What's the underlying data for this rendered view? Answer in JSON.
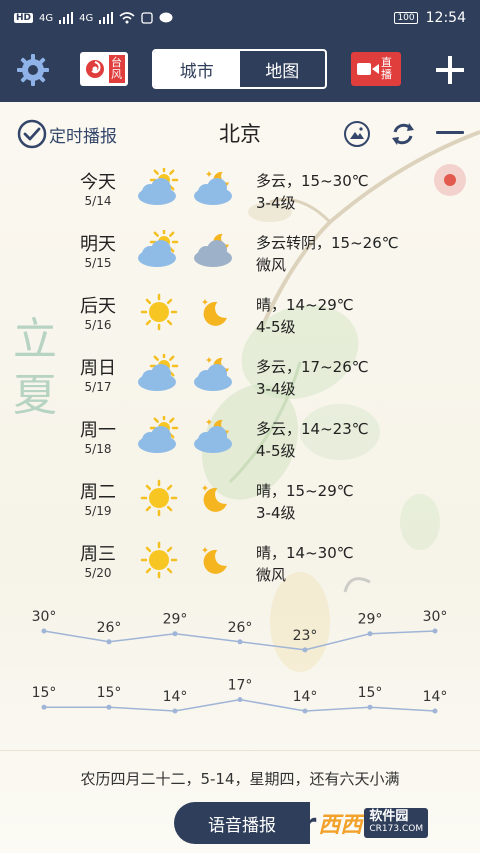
{
  "status_bar": {
    "hd": "HD",
    "signal1": "4G",
    "signal2": "4G",
    "battery": "100",
    "time": "12:54"
  },
  "top_bar": {
    "typhoon_label": "台风",
    "tabs": [
      {
        "label": "城市",
        "active": true
      },
      {
        "label": "地图",
        "active": false
      }
    ],
    "live_label": "直播",
    "accent": "#2f3e5a",
    "red": "#e03d3d"
  },
  "header": {
    "timer_label": "定时播报",
    "city": "北京"
  },
  "solar_term": "立夏",
  "forecast": [
    {
      "day": "今天",
      "date": "5/14",
      "icon_day": "partly-cloudy-day-icon",
      "icon_night": "partly-cloudy-night-icon",
      "condition": "多云，15~30℃",
      "wind": "3-4级"
    },
    {
      "day": "明天",
      "date": "5/15",
      "icon_day": "partly-cloudy-day-icon",
      "icon_night": "overcast-night-icon",
      "condition": "多云转阴，15~26℃",
      "wind": "微风"
    },
    {
      "day": "后天",
      "date": "5/16",
      "icon_day": "sunny-icon",
      "icon_night": "clear-night-icon",
      "condition": "晴，14~29℃",
      "wind": "4-5级"
    },
    {
      "day": "周日",
      "date": "5/17",
      "icon_day": "partly-cloudy-day-icon",
      "icon_night": "partly-cloudy-night-icon",
      "condition": "多云，17~26℃",
      "wind": "3-4级"
    },
    {
      "day": "周一",
      "date": "5/18",
      "icon_day": "partly-cloudy-day-icon",
      "icon_night": "partly-cloudy-night-icon",
      "condition": "多云，14~23℃",
      "wind": "4-5级"
    },
    {
      "day": "周二",
      "date": "5/19",
      "icon_day": "sunny-icon",
      "icon_night": "clear-night-icon",
      "condition": "晴，15~29℃",
      "wind": "3-4级"
    },
    {
      "day": "周三",
      "date": "5/20",
      "icon_day": "sunny-icon",
      "icon_night": "clear-night-icon",
      "condition": "晴，14~30℃",
      "wind": "微风"
    }
  ],
  "chart_data": {
    "type": "line",
    "x": [
      "5/14",
      "5/15",
      "5/16",
      "5/17",
      "5/18",
      "5/19",
      "5/20"
    ],
    "series": [
      {
        "values": [
          30,
          26,
          29,
          26,
          23,
          29,
          30
        ],
        "labels": [
          "30°",
          "26°",
          "29°",
          "26°",
          "23°",
          "29°",
          "30°"
        ]
      },
      {
        "values": [
          15,
          15,
          14,
          17,
          14,
          15,
          14
        ],
        "labels": [
          "15°",
          "15°",
          "14°",
          "17°",
          "14°",
          "15°",
          "14°"
        ]
      }
    ],
    "line_color": "#9fb4d6"
  },
  "lunar_line": "农历四月二十二，5-14，星期四，还有六天小满",
  "voice_button": "语音播报",
  "watermark": {
    "site": "西西",
    "sub": "软件园",
    "domain": "CR173.COM"
  }
}
